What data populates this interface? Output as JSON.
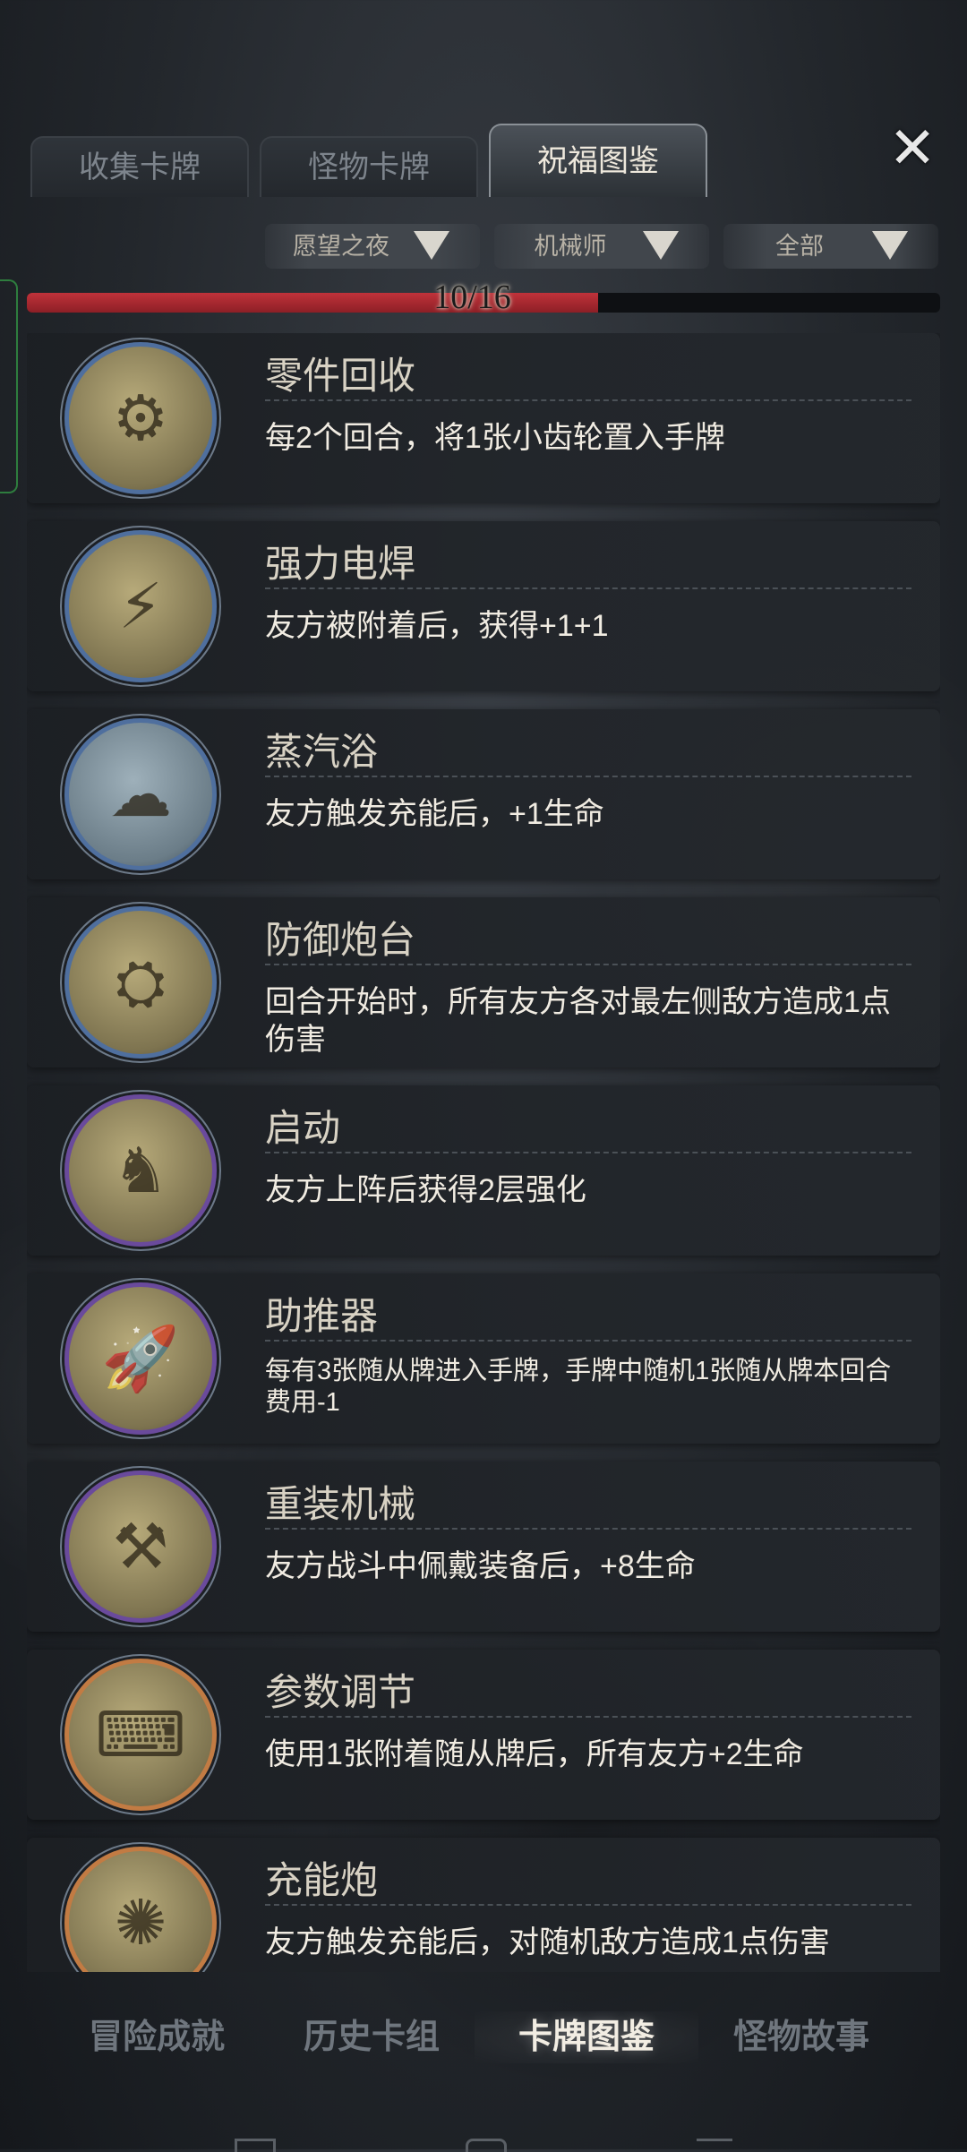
{
  "tabs": [
    {
      "label": "收集卡牌",
      "active": false
    },
    {
      "label": "怪物卡牌",
      "active": false
    },
    {
      "label": "祝福图鉴",
      "active": true
    }
  ],
  "close_icon": "close-x-icon",
  "filters": [
    {
      "label": "愿望之夜",
      "icon": "filter-funnel-icon"
    },
    {
      "label": "机械师",
      "icon": "filter-funnel-icon"
    },
    {
      "label": "全部",
      "icon": "filter-funnel-icon"
    }
  ],
  "progress": {
    "text": "10/16",
    "value": 10,
    "total": 16,
    "fill_color": "#b02a32"
  },
  "blessings": [
    {
      "title": "零件回收",
      "desc": "每2个回合，将1张小齿轮置入手牌",
      "frame": "blue",
      "icon": "hooded-scavenger-icon"
    },
    {
      "title": "强力电焊",
      "desc": "友方被附着后，获得+1+1",
      "frame": "blue",
      "icon": "welding-torch-icon"
    },
    {
      "title": "蒸汽浴",
      "desc": "友方触发充能后，+1生命",
      "frame": "blue",
      "icon": "steam-robot-icon"
    },
    {
      "title": "防御炮台",
      "desc": "回合开始时，所有友方各对最左侧敌方造成1点伤害",
      "frame": "blue",
      "icon": "cannon-turret-icon"
    },
    {
      "title": "启动",
      "desc": "友方上阵后获得2层强化",
      "frame": "purple",
      "icon": "armored-knight-icon"
    },
    {
      "title": "助推器",
      "desc": "每有3张随从牌进入手牌，手牌中随机1张随从牌本回合费用-1",
      "frame": "purple",
      "icon": "rocket-booster-icon"
    },
    {
      "title": "重装机械",
      "desc": "友方战斗中佩戴装备后，+8生命",
      "frame": "purple",
      "icon": "heavy-mech-icon"
    },
    {
      "title": "参数调节",
      "desc": "使用1张附着随从牌后，所有友方+2生命",
      "frame": "orange",
      "icon": "control-cockpit-icon"
    },
    {
      "title": "充能炮",
      "desc": "友方触发充能后，对随机敌方造成1点伤害",
      "frame": "orange",
      "icon": "charge-cannon-icon"
    }
  ],
  "bottom_nav": [
    {
      "label": "冒险成就",
      "active": false
    },
    {
      "label": "历史卡组",
      "active": false
    },
    {
      "label": "卡牌图鉴",
      "active": true
    },
    {
      "label": "怪物故事",
      "active": false
    }
  ]
}
